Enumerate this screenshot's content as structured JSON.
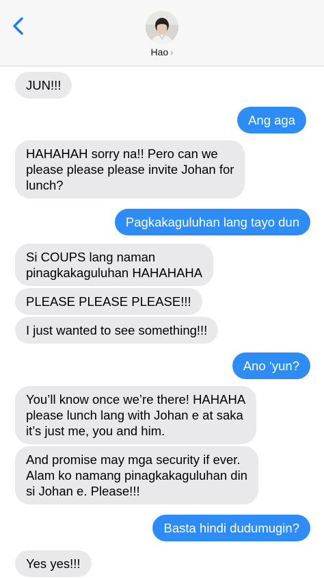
{
  "header": {
    "contact_name": "Hao",
    "chevron": "›"
  },
  "colors": {
    "incoming_bubble": "#e9e9eb",
    "outgoing_bubble": "#2e8cf7",
    "back_arrow": "#1a7cf5"
  },
  "messages": [
    {
      "dir": "in",
      "text": "JUN!!!"
    },
    {
      "dir": "out",
      "text": "Ang aga"
    },
    {
      "dir": "in",
      "text": "HAHAHAH sorry na!! Pero can we\nplease please please invite Johan for\nlunch?"
    },
    {
      "dir": "out",
      "text": "Pagkakaguluhan lang tayo dun"
    },
    {
      "dir": "in",
      "text": "Si COUPS lang naman\npinagkakaguluhan HAHAHAHA"
    },
    {
      "dir": "in",
      "text": "PLEASE PLEASE PLEASE!!!"
    },
    {
      "dir": "in",
      "text": "I just wanted to see something!!!"
    },
    {
      "dir": "out",
      "text": "Ano ‘yun?"
    },
    {
      "dir": "in",
      "text": "You’ll know once we’re there! HAHAHA\nplease lunch lang with Johan e at saka\nit’s just me, you and him."
    },
    {
      "dir": "in",
      "text": "And promise may mga security if ever.\nAlam ko namang pinagkakaguluhan din\nsi Johan e. Please!!!"
    },
    {
      "dir": "out",
      "text": "Basta hindi dudumugin?"
    },
    {
      "dir": "in",
      "text": "Yes yes!!!"
    }
  ]
}
